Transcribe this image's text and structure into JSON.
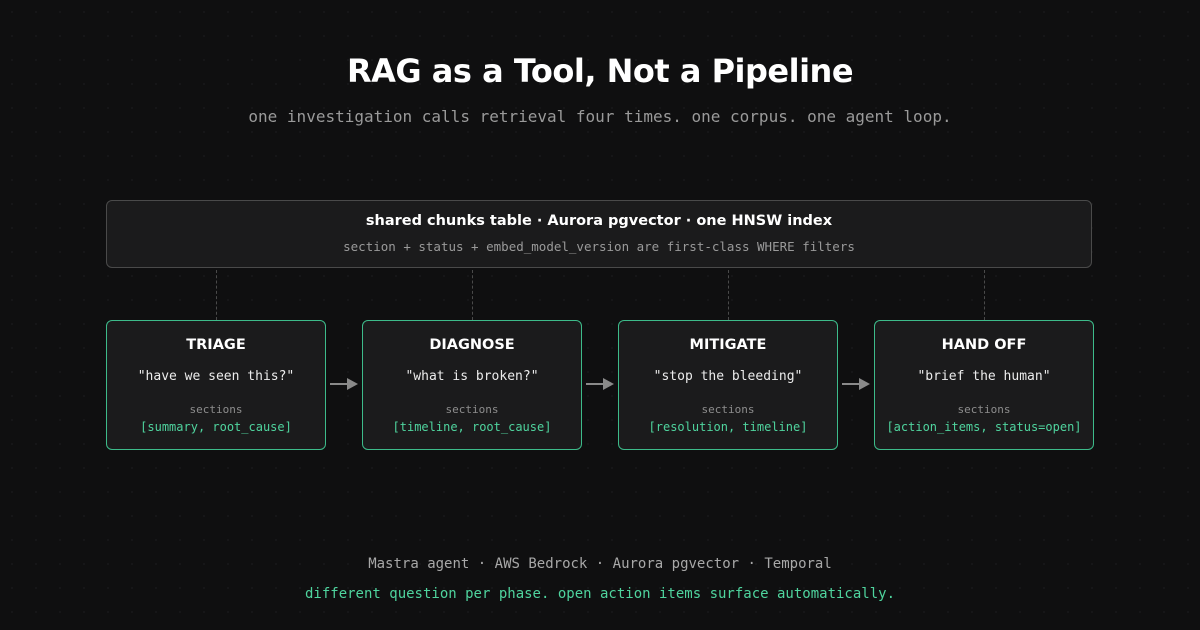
{
  "title": "RAG as a Tool, Not a Pipeline",
  "subtitle": "one investigation calls retrieval four times. one corpus. one agent loop.",
  "corpus": {
    "title": "shared chunks table · Aurora pgvector · one HNSW index",
    "subtitle": "section + status + embed_model_version are first-class WHERE filters"
  },
  "phases": [
    {
      "name": "TRIAGE",
      "question": "\"have we seen this?\"",
      "sections_label": "sections",
      "sections": "[summary, root_cause]"
    },
    {
      "name": "DIAGNOSE",
      "question": "\"what is broken?\"",
      "sections_label": "sections",
      "sections": "[timeline, root_cause]"
    },
    {
      "name": "MITIGATE",
      "question": "\"stop the bleeding\"",
      "sections_label": "sections",
      "sections": "[resolution, timeline]"
    },
    {
      "name": "HAND OFF",
      "question": "\"brief the human\"",
      "sections_label": "sections",
      "sections": "[action_items, status=open]"
    }
  ],
  "footer": {
    "stack": "Mastra agent · AWS Bedrock · Aurora pgvector · Temporal",
    "tagline": "different question per phase. open action items surface automatically."
  },
  "colors": {
    "background": "#0f0f10",
    "accent": "#3dbb8a",
    "accent_text": "#4fd49e",
    "box_fill": "#1b1b1c",
    "muted_text": "#9a9a9a"
  }
}
